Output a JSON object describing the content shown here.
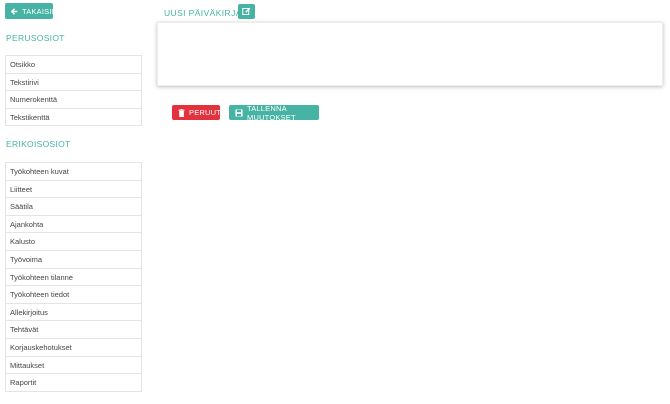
{
  "header": {
    "back_label": "TAKAISIN",
    "title": "UUSI PÄIVÄKIRJA"
  },
  "sidebar": {
    "basic_title": "PERUSOSIOT",
    "basic_items": [
      "Otsikko",
      "Tekstirivi",
      "Numerokenttä",
      "Tekstikenttä"
    ],
    "special_title": "ERIKOISOSIOT",
    "special_items": [
      "Työkohteen kuvat",
      "Liitteet",
      "Säätila",
      "Ajankohta",
      "Kalusto",
      "Työvoima",
      "Työkohteen tilanne",
      "Työkohteen tiedot",
      "Allekirjoitus",
      "Tehtävät",
      "Korjauskehotukset",
      "Mittaukset",
      "Raportit"
    ]
  },
  "actions": {
    "cancel_label": "PERUUTA",
    "save_label": "TALLENNA MUUTOKSET"
  },
  "colors": {
    "accent": "#46b3a4",
    "danger": "#e2323e"
  },
  "icons": {
    "back": "arrow-left-icon",
    "edit": "edit-icon",
    "cancel": "trash-icon",
    "save": "save-icon"
  }
}
